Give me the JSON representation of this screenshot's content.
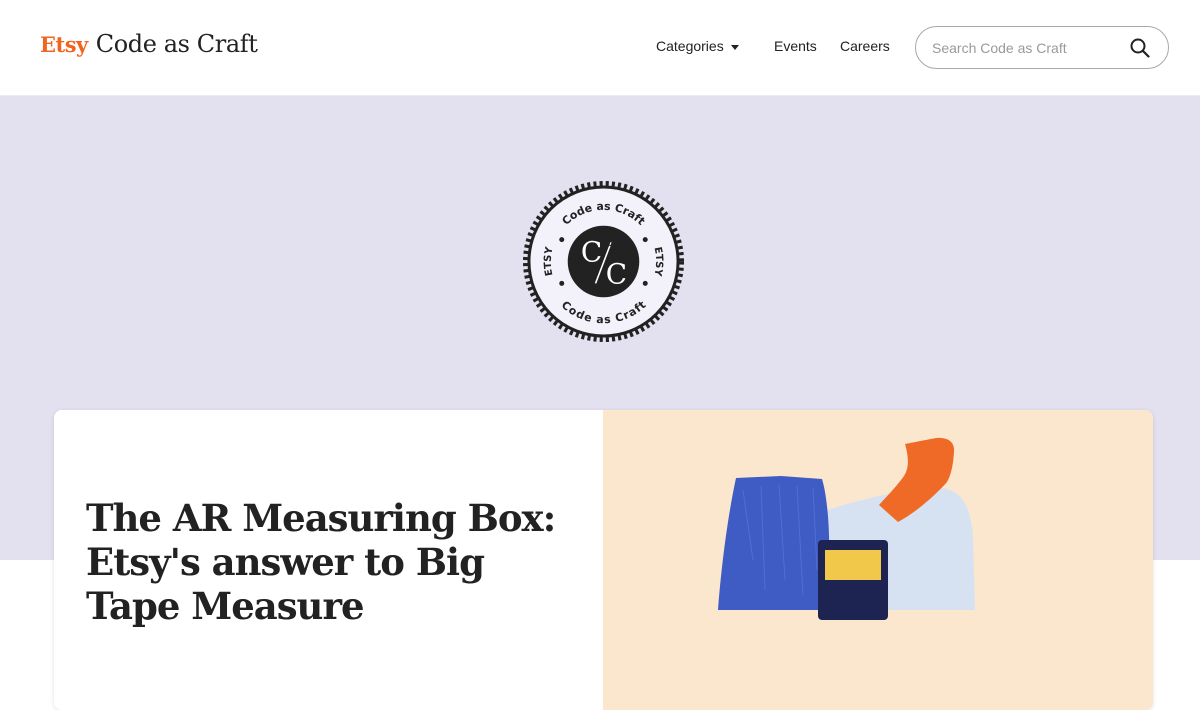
{
  "header": {
    "brand_etsy": "Etsy",
    "brand_title": "Code as Craft",
    "nav": {
      "categories": "Categories",
      "events": "Events",
      "careers": "Careers"
    },
    "search": {
      "placeholder": "Search Code as Craft",
      "value": ""
    }
  },
  "hero": {
    "badge": {
      "ring_top": "Code as Craft",
      "ring_bottom": "Code as Craft",
      "ring_left": "ETSY",
      "ring_right": "ETSY",
      "monogram_top": "C",
      "monogram_bottom": "C"
    }
  },
  "featured_post": {
    "title": "The AR Measuring Box: Etsy's answer to Big Tape Measure"
  },
  "colors": {
    "brand_orange": "#f1641e",
    "hero_background": "#e3e0f0",
    "art_background": "#fbe6ce",
    "art_blue": "#3f5bc4",
    "art_light_blue": "#d6e2f2",
    "art_orange": "#ee6a26"
  },
  "icons": {
    "search": "search-icon",
    "caret": "caret-down-icon"
  }
}
